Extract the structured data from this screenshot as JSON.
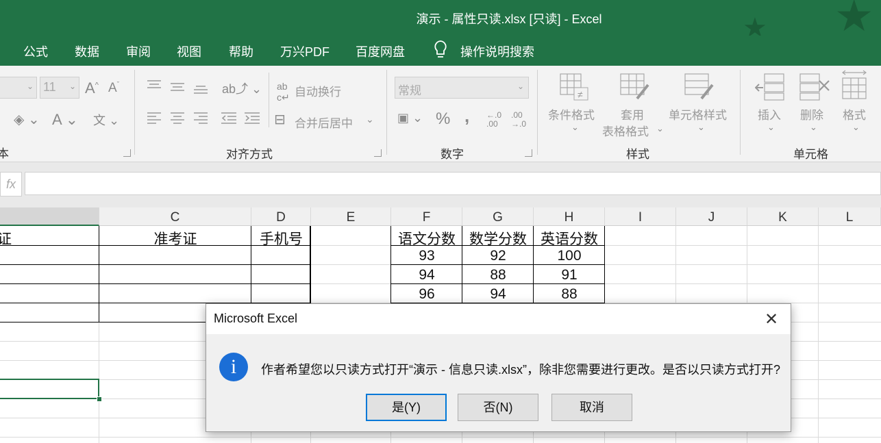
{
  "window": {
    "title": "演示 - 属性只读.xlsx  [只读]  -  Excel"
  },
  "menu": {
    "items": [
      "公式",
      "数据",
      "审阅",
      "视图",
      "帮助",
      "万兴PDF",
      "百度网盘"
    ],
    "tell_me": "操作说明搜索"
  },
  "ribbon": {
    "font": {
      "size": "11",
      "group_label": "本"
    },
    "alignment": {
      "wrap_text": "自动换行",
      "merge_center": "合并后居中",
      "group_label": "对齐方式"
    },
    "number": {
      "format": "常规",
      "percent": "%",
      "comma": ",",
      "inc_decimal_top": "←.0",
      "inc_decimal_bottom": ".00",
      "dec_decimal_top": ".00",
      "dec_decimal_bottom": "→.0",
      "group_label": "数字"
    },
    "styles": {
      "conditional": "条件格式",
      "table_line1": "套用",
      "table_line2": "表格格式",
      "cell_styles": "单元格样式",
      "group_label": "样式"
    },
    "cells": {
      "insert": "插入",
      "delete": "删除",
      "format": "格式",
      "group_label": "单元格"
    }
  },
  "formula_bar": {
    "fx": "fx",
    "value": ""
  },
  "columns": [
    "C",
    "D",
    "E",
    "F",
    "G",
    "H",
    "I",
    "J",
    "K",
    "L"
  ],
  "sheet": {
    "col_b_header_fragment": "证",
    "headers": {
      "C": "准考证",
      "D": "手机号",
      "F": "语文分数",
      "G": "数学分数",
      "H": "英语分数"
    },
    "scores": [
      {
        "F": "93",
        "G": "92",
        "H": "100"
      },
      {
        "F": "94",
        "G": "88",
        "H": "91"
      },
      {
        "F": "96",
        "G": "94",
        "H": "88"
      }
    ]
  },
  "dialog": {
    "title": "Microsoft Excel",
    "message": "作者希望您以只读方式打开“演示 - 信息只读.xlsx”，除非您需要进行更改。是否以只读方式打开?",
    "yes": "是(Y)",
    "no": "否(N)",
    "cancel": "取消",
    "icon": "info-icon"
  },
  "colors": {
    "excel_green": "#217346",
    "accent_blue": "#0078d7",
    "info_blue": "#1b6ed6"
  }
}
